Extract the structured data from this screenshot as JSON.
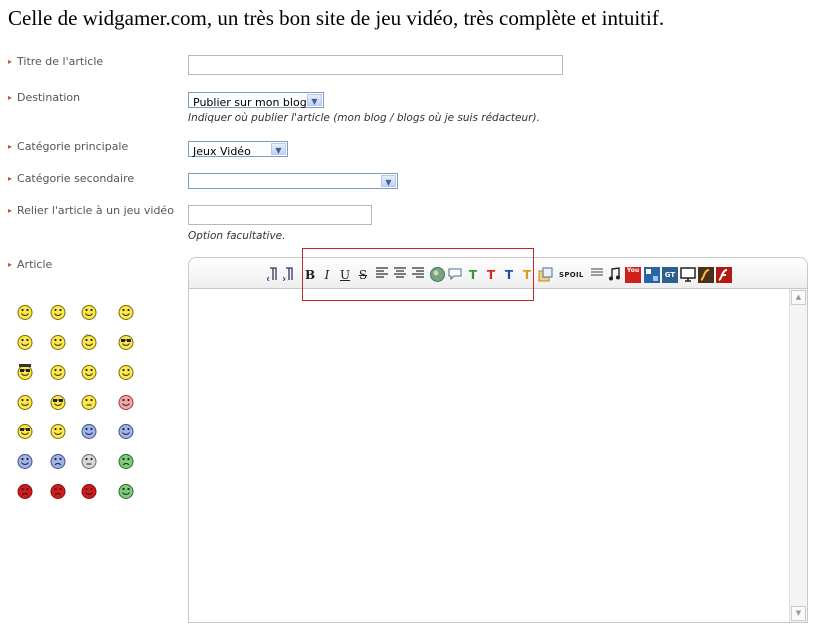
{
  "caption": "Celle de widgamer.com, un très bon site de jeu vidéo, très complète et intuitif.",
  "form": {
    "title_label": "Titre de l'article",
    "title_value": "",
    "destination_label": "Destination",
    "destination_value": "Publier sur mon blog",
    "destination_help": "Indiquer où publier l'article (mon blog / blogs où je suis rédacteur).",
    "main_category_label": "Catégorie principale",
    "main_category_value": "Jeux Vidéo",
    "secondary_category_label": "Catégorie secondaire",
    "secondary_category_value": "",
    "link_game_label": "Relier l'article à un jeu vidéo",
    "link_game_value": "",
    "link_game_help": "Option facultative.",
    "article_label": "Article"
  },
  "toolbar": {
    "bold": "B",
    "italic": "I",
    "underline": "U",
    "strike": "S",
    "spoil": "SPOIL",
    "youtube": "You",
    "text_color_glyph": "T",
    "video_glyph": "GT"
  },
  "colors": {
    "label": "#555555",
    "bullet": "#b25b3a",
    "select_border": "#7f9db9",
    "highlight": "#c0282b",
    "color_green": "#2e9a33",
    "color_red": "#d42a1e",
    "color_blue": "#1f4ea8",
    "color_orange": "#e09a1a"
  },
  "icons": {
    "align_icons": [
      "rtl-paragraph-icon",
      "ltr-paragraph-icon",
      "align-left-icon",
      "align-center-icon",
      "align-right-icon"
    ],
    "misc": [
      "image-icon",
      "speech-bubble-icon",
      "quote-icon",
      "music-icon",
      "youtube-icon",
      "dailymotion-icon",
      "gametrailers-icon",
      "screen-icon",
      "flash-icon",
      "flash-red-icon"
    ]
  },
  "smileys": [
    [
      "smile",
      "smile",
      "grin",
      "smile"
    ],
    [
      "laugh",
      "big-grin",
      "confused-question",
      "glasses"
    ],
    [
      "sunglasses-hat",
      "smile",
      "wink",
      "tongue"
    ],
    [
      "heart-eyes",
      "glasses-nerd",
      "neutral",
      "sick"
    ],
    [
      "cool-shades",
      "blush",
      "scared-blue",
      "tired-blue"
    ],
    [
      "blue-dizzy",
      "blue-sad",
      "thinking-gray",
      "green-angry"
    ],
    [
      "red-mad",
      "red-angry",
      "red-face",
      "green-sick"
    ]
  ]
}
